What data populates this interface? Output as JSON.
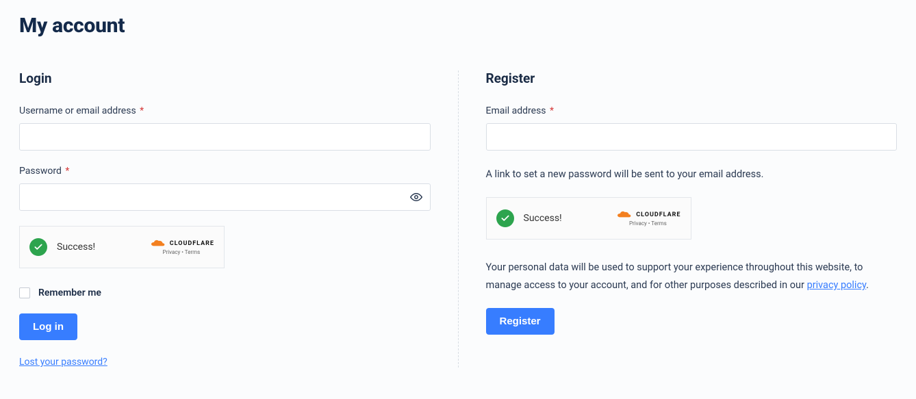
{
  "page_title": "My account",
  "login": {
    "heading": "Login",
    "username_label": "Username or email address",
    "password_label": "Password",
    "turnstile_status": "Success!",
    "cloudflare_brand": "CLOUDFLARE",
    "cloudflare_legal": "Privacy  •  Terms",
    "remember_label": "Remember me",
    "button_label": "Log in",
    "lost_link": "Lost your password?"
  },
  "register": {
    "heading": "Register",
    "email_label": "Email address",
    "link_info": "A link to set a new password will be sent to your email address.",
    "turnstile_status": "Success!",
    "cloudflare_brand": "CLOUDFLARE",
    "cloudflare_legal": "Privacy  •  Terms",
    "privacy_text_pre": "Your personal data will be used to support your experience throughout this website, to manage access to your account, and for other purposes described in our ",
    "privacy_link": "privacy policy",
    "privacy_text_post": ".",
    "button_label": "Register"
  },
  "required_mark": "*"
}
